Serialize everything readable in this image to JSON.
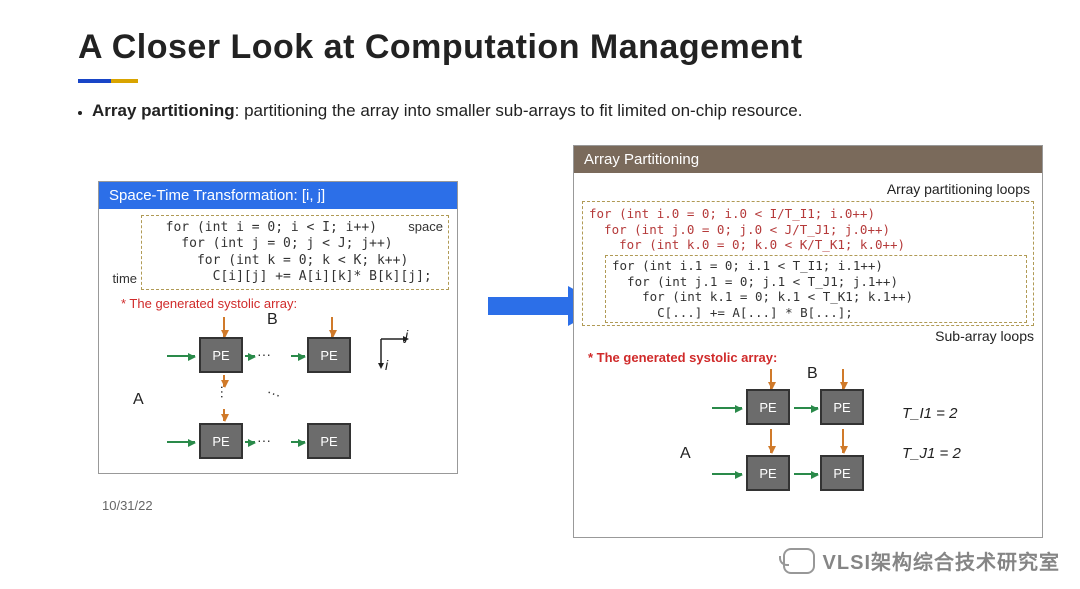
{
  "title": "A Closer Look at Computation Management",
  "bullet": {
    "term": "Array partitioning",
    "rest": ": partitioning the array into smaller sub-arrays to fit limited on-chip resource."
  },
  "left": {
    "header": "Space-Time Transformation: [i, j]",
    "tag_space": "space",
    "tag_time": "time",
    "code": "  for (int i = 0; i < I; i++)\n    for (int j = 0; j < J; j++)\n      for (int k = 0; k < K; k++)\n        C[i][j] += A[i][k]* B[k][j];",
    "caption": "* The generated systolic array:",
    "A": "A",
    "B": "B",
    "PE": "PE",
    "axis_i": "i",
    "axis_j": "j"
  },
  "right": {
    "header": "Array Partitioning",
    "cap_top": "Array partitioning loops",
    "cap_bot": "Sub-array loops",
    "outer_code": "for (int i.0 = 0; i.0 < I/T_I1; i.0++)\n  for (int j.0 = 0; j.0 < J/T_J1; j.0++)\n    for (int k.0 = 0; k.0 < K/T_K1; k.0++)",
    "inner_code": "for (int i.1 = 0; i.1 < T_I1; i.1++)\n  for (int j.1 = 0; j.1 < T_J1; j.1++)\n    for (int k.1 = 0; k.1 < T_K1; k.1++)\n      C[...] += A[...] * B[...];",
    "caption": "* The generated systolic array:",
    "A": "A",
    "B": "B",
    "PE": "PE",
    "t_i": "T_I1 = 2",
    "t_j": "T_J1 = 2"
  },
  "footer": {
    "date": "10/31/22",
    "watermark": "VLSI架构综合技术研究室"
  }
}
